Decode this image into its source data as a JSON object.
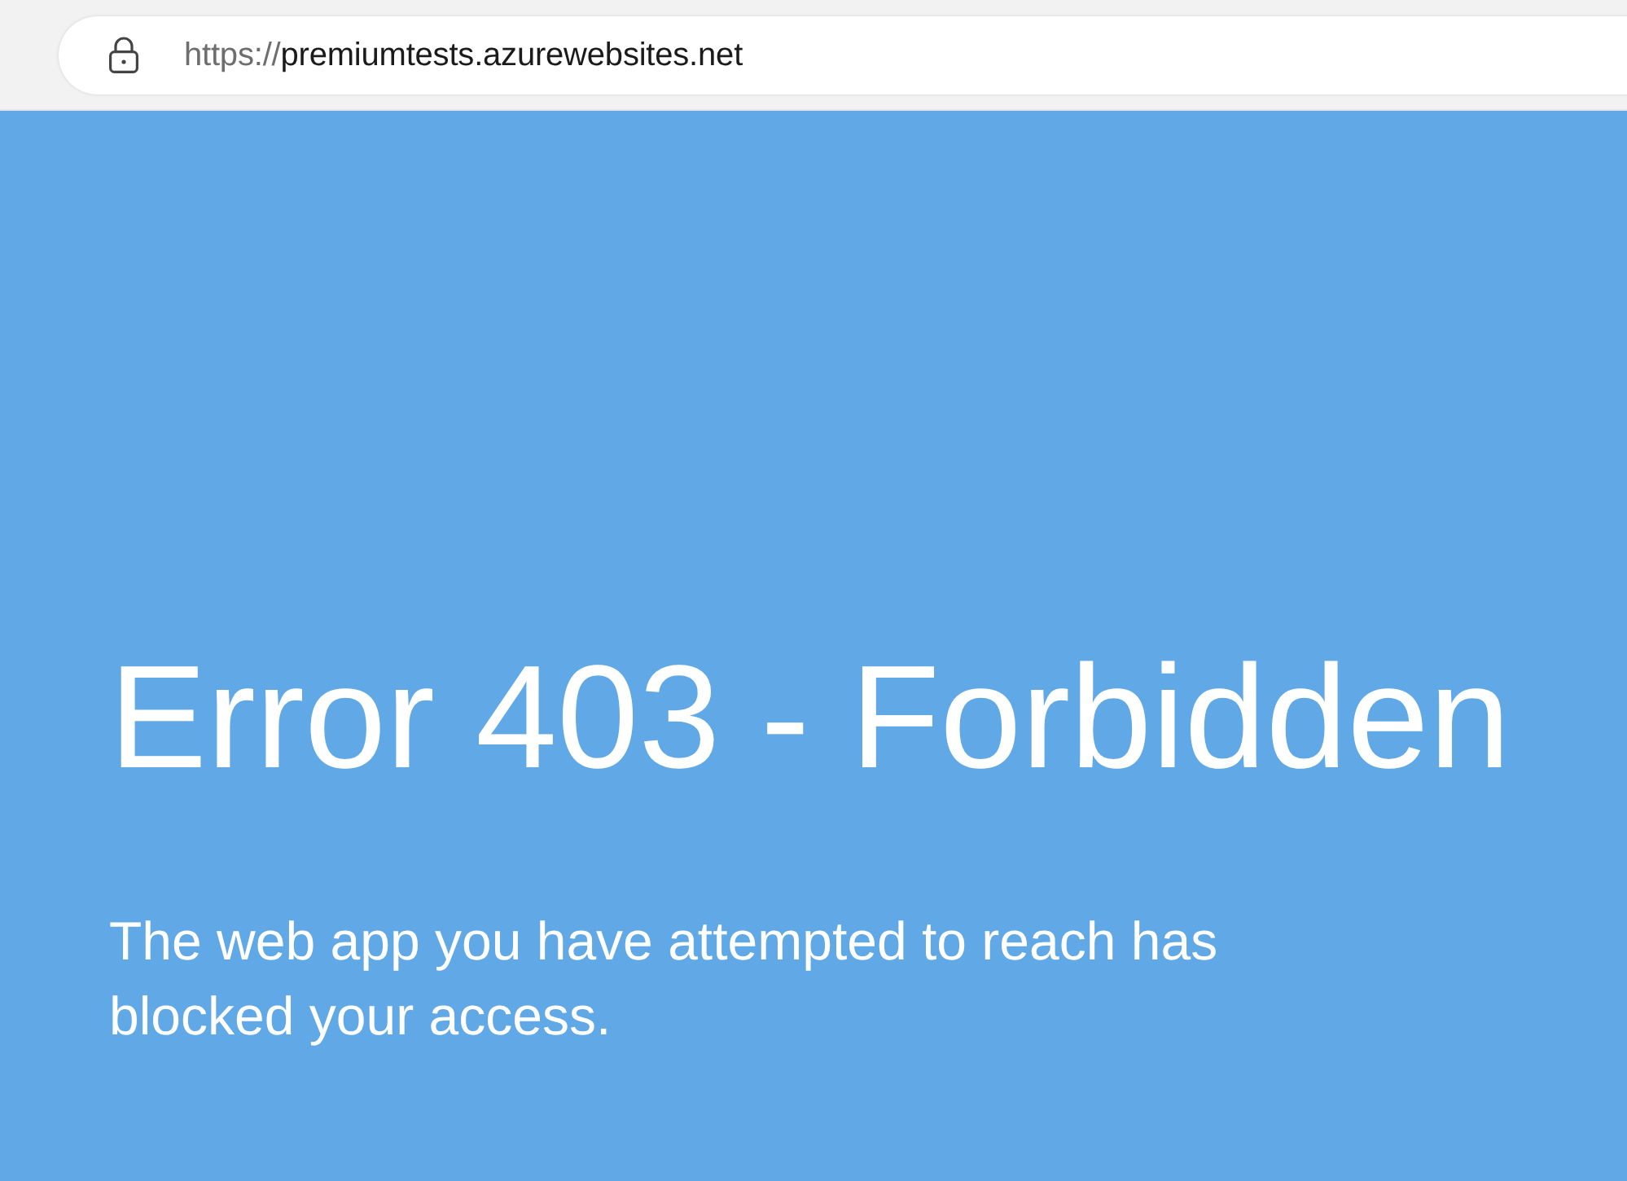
{
  "browser": {
    "address_bar": {
      "scheme": "https://",
      "host": "premiumtests.azurewebsites.net"
    }
  },
  "page": {
    "title": "Error 403 - Forbidden",
    "message": "The web app you have attempted to reach has blocked your access."
  }
}
